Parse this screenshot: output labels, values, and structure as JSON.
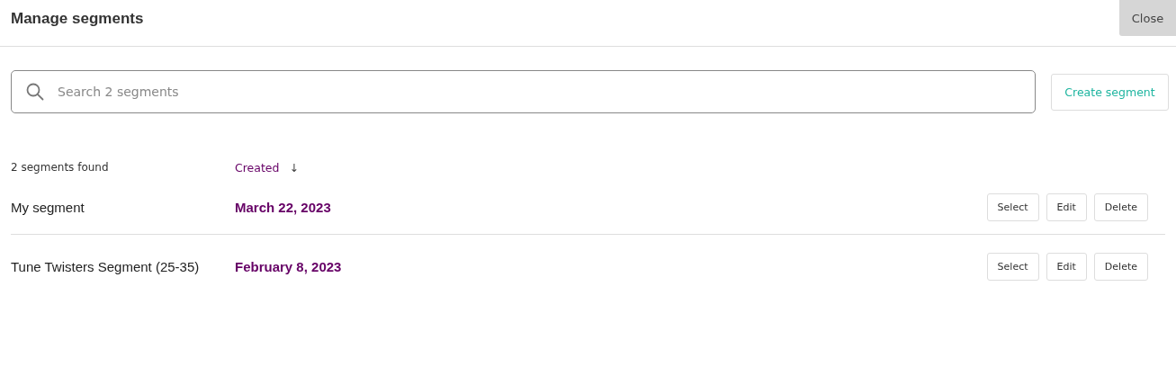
{
  "dialog": {
    "title": "Manage segments",
    "close_label": "Close"
  },
  "search": {
    "placeholder": "Search 2 segments"
  },
  "create_button": "Create segment",
  "summary": "2 segments found",
  "sort": {
    "label": "Created",
    "arrow": "↓"
  },
  "segments": [
    {
      "name": "My segment",
      "created": "March 22, 2023",
      "actions": [
        "Select",
        "Edit",
        "Delete"
      ]
    },
    {
      "name": "Tune Twisters Segment (25-35)",
      "created": "February 8, 2023",
      "actions": [
        "Select",
        "Edit",
        "Delete"
      ]
    }
  ]
}
